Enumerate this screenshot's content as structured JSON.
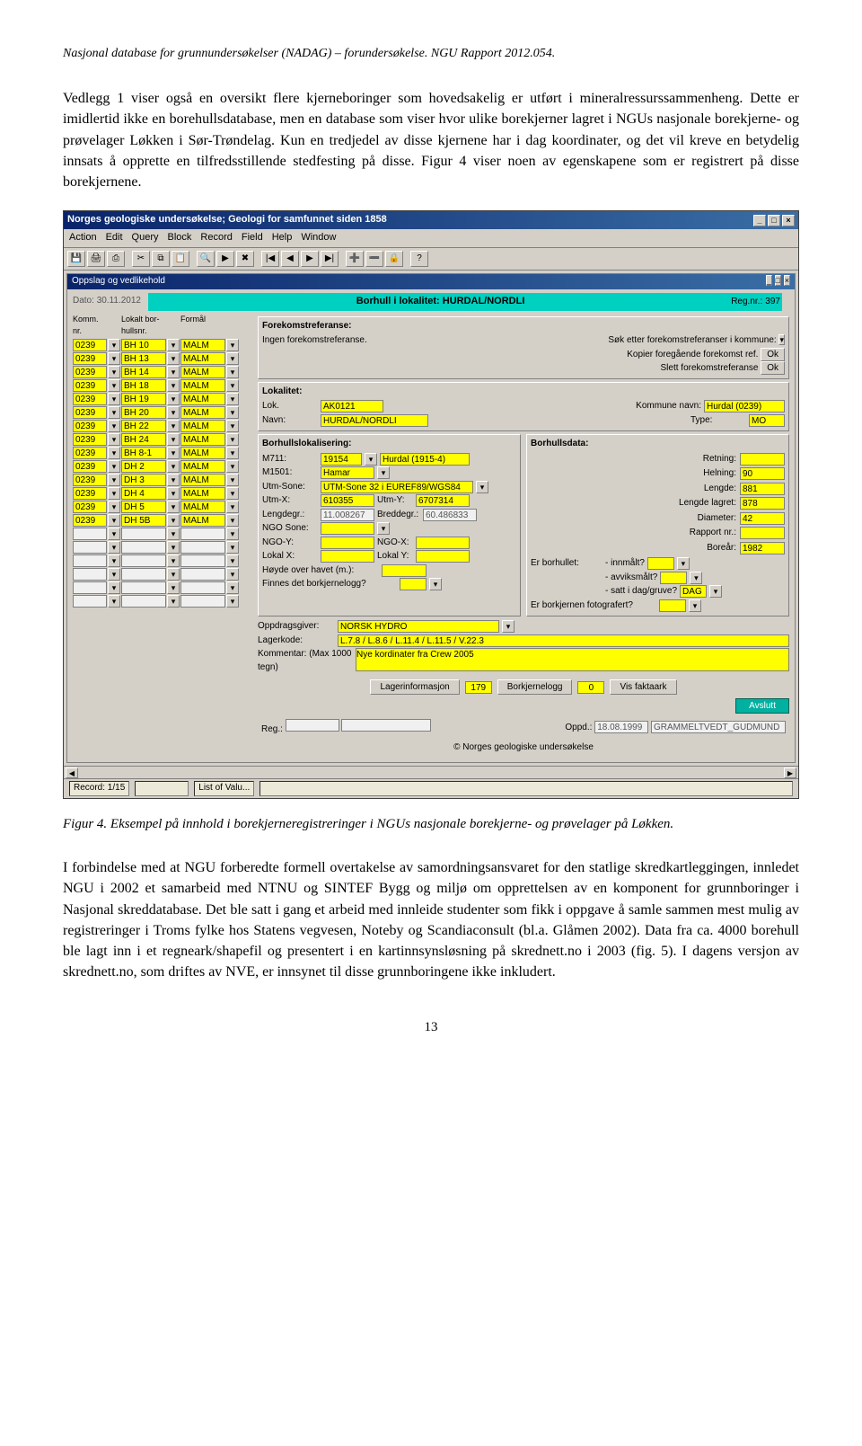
{
  "doc_header": "Nasjonal database for grunnundersøkelser (NADAG) – forundersøkelse. NGU Rapport 2012.054.",
  "para1": "Vedlegg 1 viser også en oversikt flere kjerneboringer som hovedsakelig er utført i mineralressurssammenheng. Dette er imidlertid ikke en borehullsdatabase, men en database som viser hvor ulike borekjerner lagret i NGUs nasjonale borekjerne- og prøvelager Løkken i Sør-Trøndelag. Kun en tredjedel av disse kjernene har i dag koordinater, og det vil kreve en betydelig innsats å opprette en tilfredsstillende stedfesting på disse. Figur 4 viser noen av egenskapene som er registrert på disse borekjernene.",
  "figure_caption": "Figur 4. Eksempel på innhold i borekjerneregistreringer i NGUs nasjonale borekjerne- og prøvelager på Løkken.",
  "para2": "I forbindelse med at NGU forberedte formell overtakelse av samordningsansvaret for den statlige skredkartleggingen, innledet NGU i 2002 et samarbeid med NTNU og SINTEF Bygg og miljø om opprettelsen av en komponent for grunnboringer i Nasjonal skreddatabase. Det ble satt i gang et arbeid med innleide studenter som fikk i oppgave å samle sammen mest mulig av registreringer i Troms fylke hos Statens vegvesen, Noteby og Scandiaconsult (bl.a. Glåmen 2002). Data fra ca. 4000 borehull ble lagt inn i et regneark/shapefil og presentert i en kartinnsynsløsning på skrednett.no i 2003 (fig. 5). I dagens versjon av skrednett.no, som driftes av NVE, er innsynet til disse grunnboringene ikke inkludert.",
  "page_number": "13",
  "app": {
    "title": "Norges geologiske undersøkelse;  Geologi for samfunnet siden 1858",
    "menubar": [
      "Action",
      "Edit",
      "Query",
      "Block",
      "Record",
      "Field",
      "Help",
      "Window"
    ],
    "inner_title": "Oppslag og vedlikehold",
    "date_label": "Dato:",
    "date_value": "30.11.2012",
    "header_title": "Borhull i lokalitet: HURDAL/NORDLI",
    "regnr_label": "Reg.nr.:",
    "regnr_value": "397",
    "left_headers": {
      "komm": "Komm. nr.",
      "lokalt": "Lokalt bor-hullsnr.",
      "formal": "Formål"
    },
    "rows": [
      {
        "komm": "0239",
        "hull": "BH 10",
        "formal": "MALM"
      },
      {
        "komm": "0239",
        "hull": "BH 13",
        "formal": "MALM"
      },
      {
        "komm": "0239",
        "hull": "BH 14",
        "formal": "MALM"
      },
      {
        "komm": "0239",
        "hull": "BH 18",
        "formal": "MALM"
      },
      {
        "komm": "0239",
        "hull": "BH 19",
        "formal": "MALM"
      },
      {
        "komm": "0239",
        "hull": "BH 20",
        "formal": "MALM"
      },
      {
        "komm": "0239",
        "hull": "BH 22",
        "formal": "MALM"
      },
      {
        "komm": "0239",
        "hull": "BH 24",
        "formal": "MALM"
      },
      {
        "komm": "0239",
        "hull": "BH 8-1",
        "formal": "MALM"
      },
      {
        "komm": "0239",
        "hull": "DH 2",
        "formal": "MALM"
      },
      {
        "komm": "0239",
        "hull": "DH 3",
        "formal": "MALM"
      },
      {
        "komm": "0239",
        "hull": "DH 4",
        "formal": "MALM"
      },
      {
        "komm": "0239",
        "hull": "DH 5",
        "formal": "MALM"
      },
      {
        "komm": "0239",
        "hull": "DH 5B",
        "formal": "MALM"
      }
    ],
    "forekomst": {
      "title": "Forekomstreferanse:",
      "ingen": "Ingen forekomstreferanse.",
      "sok": "Søk etter forekomstreferanser i kommune:",
      "kopier": "Kopier foregående forekomst ref.",
      "slett": "Slett forekomstreferanse",
      "ok": "Ok"
    },
    "lokalitet": {
      "title": "Lokalitet:",
      "lok_label": "Lok.",
      "lok": "AK0121",
      "kommune_label": "Kommune navn:",
      "kommune": "Hurdal (0239)",
      "navn_label": "Navn:",
      "navn": "HURDAL/NORDLI",
      "type_label": "Type:",
      "type": "MO"
    },
    "lokal": {
      "title": "Borhullslokalisering:",
      "m711_label": "M711:",
      "m711a": "19154",
      "m711b": "Hurdal (1915-4)",
      "m1501_label": "M1501:",
      "m1501": "Hamar",
      "utmsone_label": "Utm-Sone:",
      "utmsone": "UTM-Sone 32 i  EUREF89/WGS84",
      "utmx_label": "Utm-X:",
      "utmx": "610355",
      "utmy_label": "Utm-Y:",
      "utmy": "6707314",
      "lengde_label": "Lengdegr.:",
      "lengdegr": "11.008267",
      "bredde_label": "Breddegr.:",
      "breddegr": "60.486833",
      "ngosone_label": "NGO Sone:",
      "ngoy_label": "NGO-Y:",
      "ngox_label": "NGO-X:",
      "lokalx_label": "Lokal X:",
      "lokaly_label": "Lokal Y:",
      "hoyde_label": "Høyde over havet (m.):",
      "finnes_label": "Finnes det borkjernelogg?"
    },
    "borhull": {
      "title": "Borhullsdata:",
      "retning_label": "Retning:",
      "retning": "",
      "helning_label": "Helning:",
      "helning": "90",
      "lengde_label": "Lengde:",
      "lengde": "881",
      "lengdel_label": "Lengde lagret:",
      "lengdel": "878",
      "diameter_label": "Diameter:",
      "diameter": "42",
      "rapport_label": "Rapport nr.:",
      "borear_label": "Boreår:",
      "borear": "1982",
      "erborhullet_label": "Er borhullet:",
      "innmalt_label": "- innmålt?",
      "avviks_label": "- avviksmålt?",
      "satt_label": "- satt i dag/gruve?",
      "satt_value": "DAG",
      "fotografert_label": "Er borkjernen fotografert?"
    },
    "oppdrag": {
      "oppdragsgiver_label": "Oppdragsgiver:",
      "oppdragsgiver": "NORSK HYDRO",
      "lagerkode_label": "Lagerkode:",
      "lagerkode": "L.7.8 / L.8.6 / L.11.4 / L.11.5 / V.22.3",
      "kommentar_label": "Kommentar: (Max 1000 tegn)",
      "kommentar": "Nye kordinater fra Crew 2005"
    },
    "buttons": {
      "lagerinfo": "Lagerinformasjon",
      "lagerinfo_n": "179",
      "borkjerne": "Borkjernelogg",
      "borkjerne_n": "0",
      "faktaark": "Vis faktaark",
      "avslutt": "Avslutt"
    },
    "footer": {
      "reg_label": "Reg.:",
      "oppd_label": "Oppd.:",
      "oppd_date": "18.08.1999",
      "oppd_user": "GRAMMELTVEDT_GUDMUND",
      "copyright": "© Norges geologiske undersøkelse"
    },
    "status": {
      "record": "Record: 1/15",
      "list": "List of Valu..."
    }
  }
}
